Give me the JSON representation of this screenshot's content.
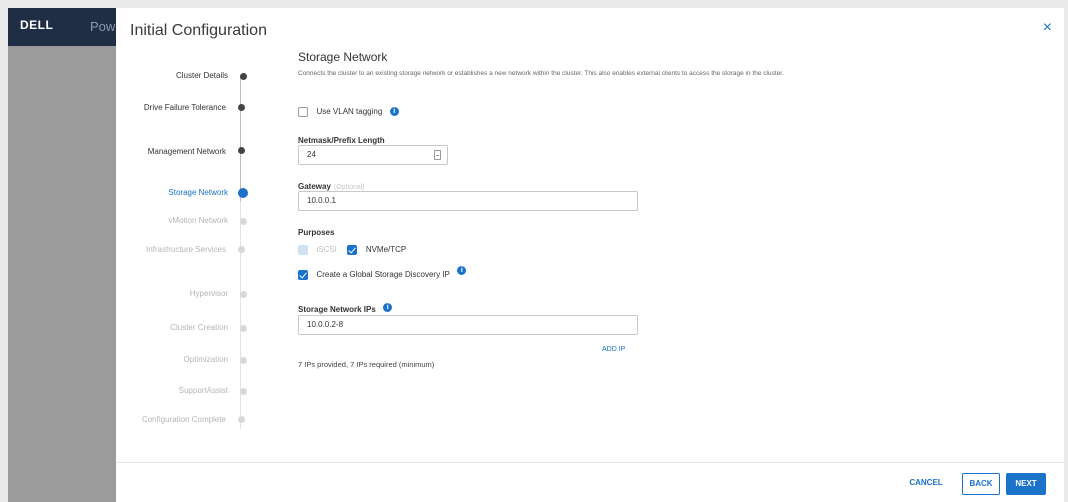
{
  "app": {
    "logo": "DELL",
    "name": "Pow"
  },
  "modal": {
    "title": "Initial Configuration",
    "close_label": "×"
  },
  "steps": [
    {
      "label": "Cluster Details",
      "state": "done"
    },
    {
      "label": "Drive Failure Tolerance",
      "state": "done"
    },
    {
      "label": "Management Network",
      "state": "done"
    },
    {
      "label": "Storage Network",
      "state": "current"
    },
    {
      "label": "vMotion Network",
      "state": "pending"
    },
    {
      "label": "Infrastructure Services",
      "state": "pending"
    },
    {
      "label": "Hypervisor",
      "state": "pending"
    },
    {
      "label": "Cluster Creation",
      "state": "pending"
    },
    {
      "label": "Optimization",
      "state": "pending"
    },
    {
      "label": "SupportAssist",
      "state": "pending"
    },
    {
      "label": "Configuration Complete",
      "state": "pending"
    }
  ],
  "content": {
    "title": "Storage Network",
    "description": "Connects the cluster to an existing storage network or establishes a new network within the cluster. This also enables external clients to access the storage in the cluster.",
    "vlan_label": "Use VLAN tagging",
    "vlan_checked": false,
    "netmask_label": "Netmask/Prefix Length",
    "netmask_value": "24",
    "gateway_label": "Gateway",
    "gateway_optional": "(Optional)",
    "gateway_value": "10.0.0.1",
    "purposes_label": "Purposes",
    "iscsi_label": "iSCSI",
    "nvme_label": "NVMe/TCP",
    "global_discovery_label": "Create a Global Storage Discovery IP",
    "storage_ips_label": "Storage Network IPs",
    "storage_ips_value": "10.0.0.2-8",
    "add_ip_label": "ADD IP",
    "ips_note": "7 IPs provided, 7 IPs required (minimum)"
  },
  "footer": {
    "cancel": "CANCEL",
    "back": "BACK",
    "next": "NEXT"
  },
  "colors": {
    "accent": "#1a72c9",
    "app_bar": "#1f2e45"
  }
}
